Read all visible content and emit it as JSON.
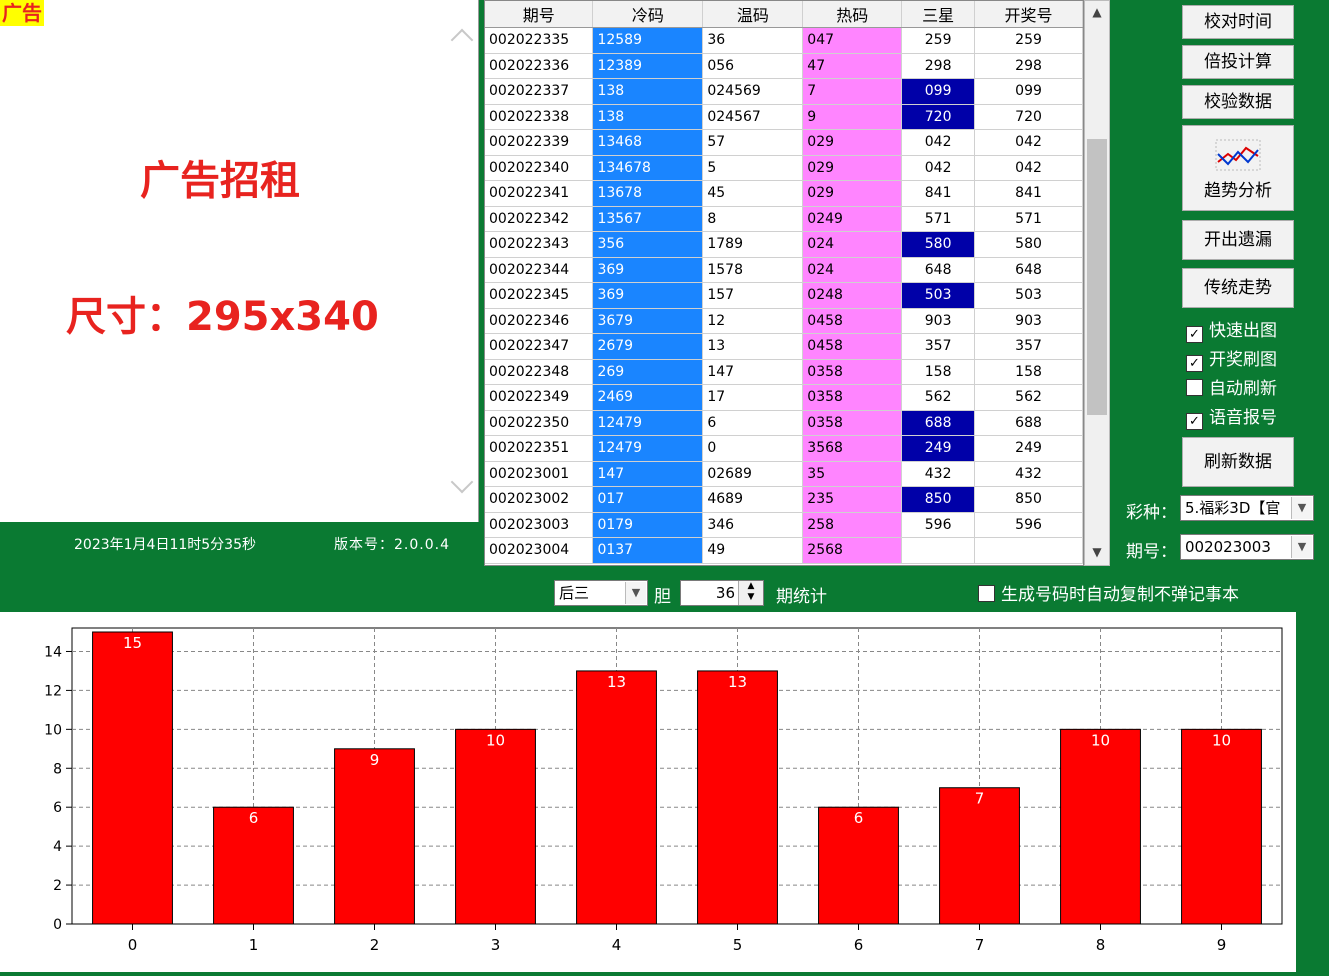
{
  "ad": {
    "tag": "广告",
    "title": "广告招租",
    "size": "尺寸：295x340",
    "datetime": "2023年1月4日11时5分35秒",
    "version": "版本号：2.0.0.4"
  },
  "table": {
    "headers": [
      "期号",
      "冷码",
      "温码",
      "热码",
      "三星",
      "开奖号"
    ],
    "rows": [
      [
        "002022335",
        "12589",
        "36",
        "047",
        "259",
        "259"
      ],
      [
        "002022336",
        "12389",
        "056",
        "47",
        "298",
        "298"
      ],
      [
        "002022337",
        "138",
        "024569",
        "7",
        "099",
        "099"
      ],
      [
        "002022338",
        "138",
        "024567",
        "9",
        "720",
        "720"
      ],
      [
        "002022339",
        "13468",
        "57",
        "029",
        "042",
        "042"
      ],
      [
        "002022340",
        "134678",
        "5",
        "029",
        "042",
        "042"
      ],
      [
        "002022341",
        "13678",
        "45",
        "029",
        "841",
        "841"
      ],
      [
        "002022342",
        "13567",
        "8",
        "0249",
        "571",
        "571"
      ],
      [
        "002022343",
        "356",
        "1789",
        "024",
        "580",
        "580"
      ],
      [
        "002022344",
        "369",
        "1578",
        "024",
        "648",
        "648"
      ],
      [
        "002022345",
        "369",
        "157",
        "0248",
        "503",
        "503"
      ],
      [
        "002022346",
        "3679",
        "12",
        "0458",
        "903",
        "903"
      ],
      [
        "002022347",
        "2679",
        "13",
        "0458",
        "357",
        "357"
      ],
      [
        "002022348",
        "269",
        "147",
        "0358",
        "158",
        "158"
      ],
      [
        "002022349",
        "2469",
        "17",
        "0358",
        "562",
        "562"
      ],
      [
        "002022350",
        "12479",
        "6",
        "0358",
        "688",
        "688"
      ],
      [
        "002022351",
        "12479",
        "0",
        "3568",
        "249",
        "249"
      ],
      [
        "002023001",
        "147",
        "02689",
        "35",
        "432",
        "432"
      ],
      [
        "002023002",
        "017",
        "4689",
        "235",
        "850",
        "850"
      ],
      [
        "002023003",
        "0179",
        "346",
        "258",
        "596",
        "596"
      ],
      [
        "002023004",
        "0137",
        "49",
        "2568",
        "",
        ""
      ]
    ],
    "highlighted_rows": [
      2,
      3,
      8,
      10,
      15,
      16,
      18
    ]
  },
  "buttons": {
    "check_time": "校对时间",
    "multiple_calc": "倍投计算",
    "verify_data": "校验数据",
    "trend_analysis": "趋势分析",
    "missing": "开出遗漏",
    "traditional_trend": "传统走势",
    "refresh_data": "刷新数据"
  },
  "checkboxes": [
    {
      "label": "快速出图",
      "checked": true
    },
    {
      "label": "开奖刷图",
      "checked": true
    },
    {
      "label": "自动刷新",
      "checked": false
    },
    {
      "label": "语音报号",
      "checked": true
    }
  ],
  "lottery": {
    "label": "彩种：",
    "value": "5.福彩3D【官"
  },
  "period": {
    "label": "期号：",
    "value": "002023003"
  },
  "filter": {
    "position": "后三",
    "unit": "胆",
    "count": "36",
    "suffix": "期统计",
    "auto_copy": {
      "label": "生成号码时自动复制不弹记事本",
      "checked": false
    }
  },
  "colors": {
    "cold": "#1a85ff",
    "hot": "#ff85ff",
    "highlight": "#0000a8",
    "bar": "#ff0000",
    "background": "#0a7a32"
  },
  "chart_data": {
    "type": "bar",
    "categories": [
      "0",
      "1",
      "2",
      "3",
      "4",
      "5",
      "6",
      "7",
      "8",
      "9"
    ],
    "values": [
      15,
      6,
      9,
      10,
      13,
      13,
      6,
      7,
      10,
      10
    ],
    "yticks": [
      0,
      2,
      4,
      6,
      8,
      10,
      12,
      14
    ],
    "ylim": [
      0,
      15
    ],
    "grid": true,
    "data_labels": true
  }
}
